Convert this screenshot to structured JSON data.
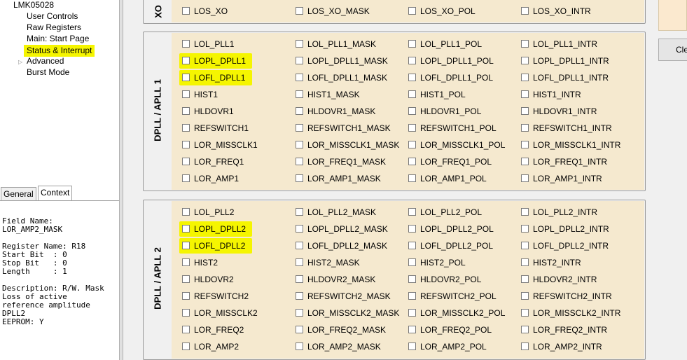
{
  "tree": {
    "root": "LMK05028",
    "items": [
      "User Controls",
      "Raw Registers",
      "Main: Start Page",
      "Status & Interrupt",
      "Advanced",
      "Burst Mode"
    ]
  },
  "tabs": [
    "General",
    "Context"
  ],
  "context": {
    "field_name_label": "Field Name:",
    "field_name": "LOR_AMP2_MASK",
    "register": "Register Name: R18",
    "start_bit": "Start Bit  : 0",
    "stop_bit": "Stop Bit   : 0",
    "length": "Length     : 1",
    "description": "Description: R/W. Mask",
    "desc2": "Loss of active",
    "desc3": "reference amplitude",
    "desc4": "DPLL2",
    "eeprom": "EEPROM: Y"
  },
  "clear_label": "Cle",
  "group0": {
    "label": "XO",
    "rows": [
      [
        "LOS_XO",
        "LOS_XO_MASK",
        "LOS_XO_POL",
        "LOS_XO_INTR"
      ]
    ]
  },
  "group1": {
    "label": "DPLL / APLL 1",
    "rows": [
      [
        "LOL_PLL1",
        "LOL_PLL1_MASK",
        "LOL_PLL1_POL",
        "LOL_PLL1_INTR"
      ],
      [
        "LOPL_DPLL1",
        "LOPL_DPLL1_MASK",
        "LOPL_DPLL1_POL",
        "LOPL_DPLL1_INTR"
      ],
      [
        "LOFL_DPLL1",
        "LOFL_DPLL1_MASK",
        "LOFL_DPLL1_POL",
        "LOFL_DPLL1_INTR"
      ],
      [
        "HIST1",
        "HIST1_MASK",
        "HIST1_POL",
        "HIST1_INTR"
      ],
      [
        "HLDOVR1",
        "HLDOVR1_MASK",
        "HLDOVR1_POL",
        "HLDOVR1_INTR"
      ],
      [
        "REFSWITCH1",
        "REFSWITCH1_MASK",
        "REFSWITCH1_POL",
        "REFSWITCH1_INTR"
      ],
      [
        "LOR_MISSCLK1",
        "LOR_MISSCLK1_MASK",
        "LOR_MISSCLK1_POL",
        "LOR_MISSCLK1_INTR"
      ],
      [
        "LOR_FREQ1",
        "LOR_FREQ1_MASK",
        "LOR_FREQ1_POL",
        "LOR_FREQ1_INTR"
      ],
      [
        "LOR_AMP1",
        "LOR_AMP1_MASK",
        "LOR_AMP1_POL",
        "LOR_AMP1_INTR"
      ]
    ]
  },
  "group2": {
    "label": "DPLL / APLL 2",
    "rows": [
      [
        "LOL_PLL2",
        "LOL_PLL2_MASK",
        "LOL_PLL2_POL",
        "LOL_PLL2_INTR"
      ],
      [
        "LOPL_DPLL2",
        "LOPL_DPLL2_MASK",
        "LOPL_DPLL2_POL",
        "LOPL_DPLL2_INTR"
      ],
      [
        "LOFL_DPLL2",
        "LOFL_DPLL2_MASK",
        "LOFL_DPLL2_POL",
        "LOFL_DPLL2_INTR"
      ],
      [
        "HIST2",
        "HIST2_MASK",
        "HIST2_POL",
        "HIST2_INTR"
      ],
      [
        "HLDOVR2",
        "HLDOVR2_MASK",
        "HLDOVR2_POL",
        "HLDOVR2_INTR"
      ],
      [
        "REFSWITCH2",
        "REFSWITCH2_MASK",
        "REFSWITCH2_POL",
        "REFSWITCH2_INTR"
      ],
      [
        "LOR_MISSCLK2",
        "LOR_MISSCLK2_MASK",
        "LOR_MISSCLK2_POL",
        "LOR_MISSCLK2_INTR"
      ],
      [
        "LOR_FREQ2",
        "LOR_FREQ2_MASK",
        "LOR_FREQ2_POL",
        "LOR_FREQ2_INTR"
      ],
      [
        "LOR_AMP2",
        "LOR_AMP2_MASK",
        "LOR_AMP2_POL",
        "LOR_AMP2_INTR"
      ]
    ]
  },
  "highlight_color": "#f5f500",
  "panel_color": "#f5e9cf"
}
